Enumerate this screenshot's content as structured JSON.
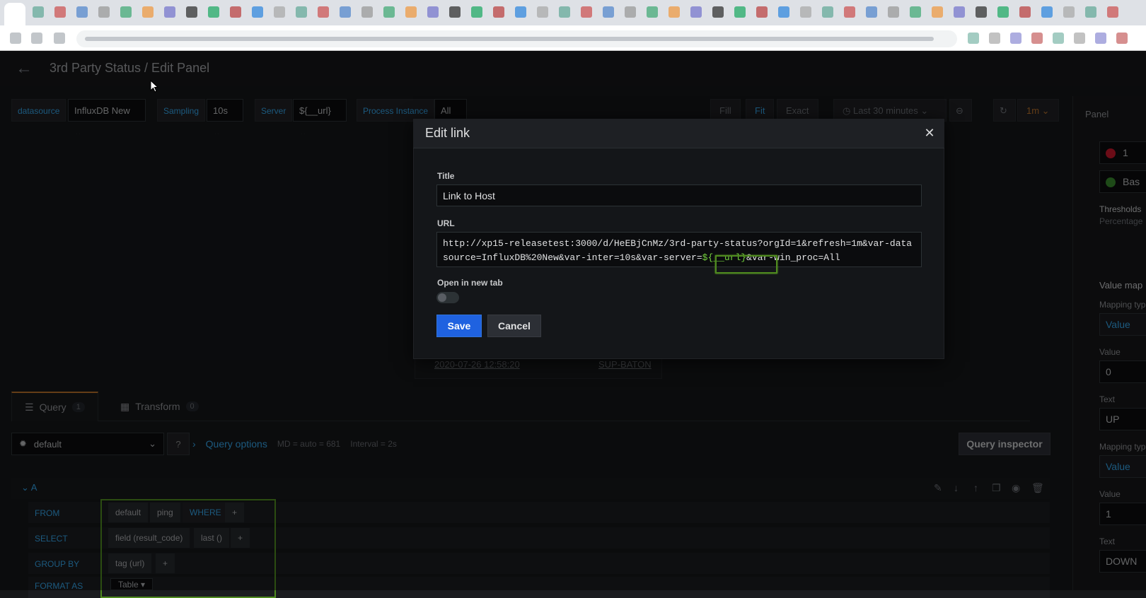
{
  "header": {
    "title": "3rd Party Status / Edit Panel"
  },
  "variables": {
    "datasource_label": "datasource",
    "datasource_value": "InfluxDB New",
    "sampling_label": "Sampling",
    "sampling_value": "10s",
    "server_label": "Server",
    "server_value": "${__url}",
    "process_label": "Process Instance",
    "process_value": "All"
  },
  "view_buttons": {
    "fill": "Fill",
    "fit": "Fit",
    "exact": "Exact"
  },
  "time": {
    "range": "Last 30 minutes",
    "refresh": "1m"
  },
  "right_panel": {
    "tab": "Panel",
    "threshold_value": "1",
    "base_label": "Bas",
    "thresholds_label": "Thresholds",
    "percentage_label": "Percentage",
    "value_mappings_label": "Value map",
    "mapping_type_label": "Mapping typ",
    "mapping_type_value": "Value",
    "value_label": "Value",
    "value_0": "0",
    "text_label": "Text",
    "text_up": "UP",
    "value_1": "1",
    "text_down": "DOWN"
  },
  "table": {
    "cell_time": "2020-07-26 12:58:20",
    "cell_host": "SUP-BATON"
  },
  "query_tabs": {
    "query_label": "Query",
    "query_count": "1",
    "transform_label": "Transform",
    "transform_count": "0"
  },
  "query_bar": {
    "datasource": "default",
    "options_label": "Query options",
    "md": "MD = auto = 681",
    "interval": "Interval = 2s",
    "inspector": "Query inspector"
  },
  "query_row": {
    "name": "A",
    "from_label": "FROM",
    "from_db": "default",
    "from_measurement": "ping",
    "where_label": "WHERE",
    "select_label": "SELECT",
    "select_field": "field (result_code)",
    "select_fn": "last ()",
    "group_label": "GROUP BY",
    "group_tag": "tag (url)",
    "format_label": "FORMAT AS",
    "format_value": "Table",
    "plus": "+"
  },
  "modal": {
    "title": "Edit link",
    "title_label": "Title",
    "title_value": "Link to Host",
    "url_label": "URL",
    "url_part1": "http://xp15-releasetest:3000/d/HeEBjCnMz/3rd-party-status?orgId=1&refresh=1m&var-datasource=InfluxDB%20New&var-inter=10s&var-server=",
    "url_var": "${__url}",
    "url_part2": "&var-win_proc=All",
    "new_tab_label": "Open in new tab",
    "save": "Save",
    "cancel": "Cancel"
  },
  "colors": {
    "accent": "#33a2e5",
    "primary_button": "#1f62e0",
    "highlight": "#4f8a1f",
    "threshold_red": "#c4162a",
    "threshold_green": "#37872d"
  }
}
